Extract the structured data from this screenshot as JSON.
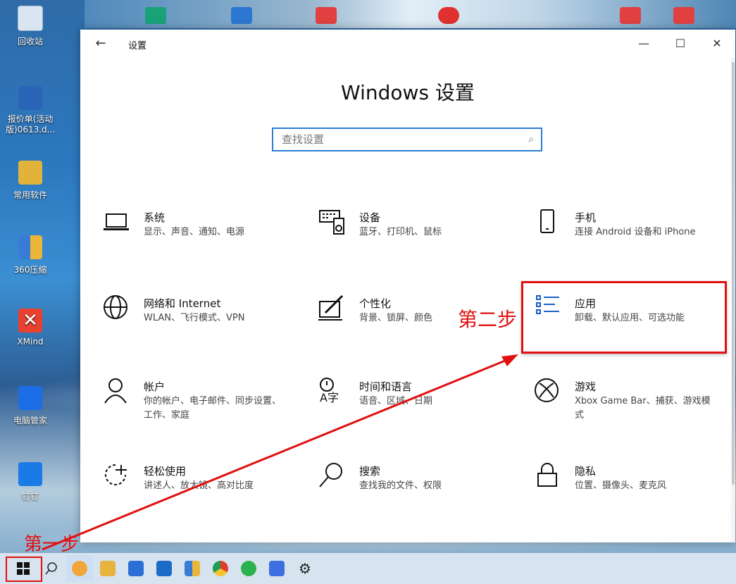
{
  "desktop": {
    "icons": [
      {
        "name": "recycle-bin",
        "label": "回收站"
      },
      {
        "name": "doc-file",
        "label": "报价单(活动\n版)0613.d..."
      },
      {
        "name": "software-folder",
        "label": "常用软件"
      },
      {
        "name": "zip-app",
        "label": "360压缩"
      },
      {
        "name": "xmind-app",
        "label": "XMind"
      },
      {
        "name": "pc-manager-app",
        "label": "电脑管家"
      },
      {
        "name": "nail-app",
        "label": "钉钉"
      }
    ]
  },
  "window": {
    "title": "设置",
    "main_title": "Windows 设置",
    "search": {
      "placeholder": "查找设置"
    },
    "controls": {
      "minimize": "—",
      "maximize": "☐",
      "close": "✕"
    },
    "tiles": [
      {
        "id": "system",
        "icon": "laptop-icon",
        "name": "系统",
        "desc": "显示、声音、通知、电源"
      },
      {
        "id": "devices",
        "icon": "keyboard-speaker-icon",
        "name": "设备",
        "desc": "蓝牙、打印机、鼠标"
      },
      {
        "id": "phone",
        "icon": "phone-icon",
        "name": "手机",
        "desc": "连接 Android 设备和 iPhone"
      },
      {
        "id": "network",
        "icon": "globe-icon",
        "name": "网络和 Internet",
        "desc": "WLAN、飞行模式、VPN"
      },
      {
        "id": "personalize",
        "icon": "pen-tablet-icon",
        "name": "个性化",
        "desc": "背景、锁屏、颜色"
      },
      {
        "id": "apps",
        "icon": "list-icon",
        "name": "应用",
        "desc": "卸载、默认应用、可选功能"
      },
      {
        "id": "accounts",
        "icon": "person-icon",
        "name": "帐户",
        "desc": "你的帐户、电子邮件、同步设置、工作、家庭"
      },
      {
        "id": "time-language",
        "icon": "time-language-icon",
        "name": "时间和语言",
        "desc": "语音、区域、日期"
      },
      {
        "id": "gaming",
        "icon": "xbox-icon",
        "name": "游戏",
        "desc": "Xbox Game Bar、捕获、游戏模式"
      },
      {
        "id": "ease",
        "icon": "timer-icon",
        "name": "轻松使用",
        "desc": "讲述人、放大镜、高对比度"
      },
      {
        "id": "search",
        "icon": "magnifier-icon",
        "name": "搜索",
        "desc": "查找我的文件、权限"
      },
      {
        "id": "privacy",
        "icon": "lock-icon",
        "name": "隐私",
        "desc": "位置、摄像头、麦克风"
      }
    ]
  },
  "annotations": {
    "step1": "第一步",
    "step2": "第二步",
    "color": "#e01010"
  },
  "taskbar": {
    "items": [
      "start-icon",
      "search-icon",
      "browser-app",
      "file-explorer",
      "app-blue",
      "app-store",
      "app-colorful",
      "chrome-icon",
      "wechat-icon",
      "camera-app",
      "gear-icon"
    ]
  }
}
